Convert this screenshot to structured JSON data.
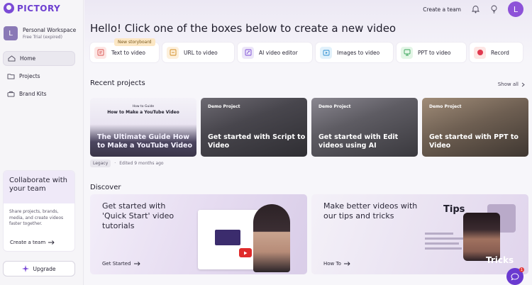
{
  "brand": {
    "name": "PICTORY",
    "color": "#6d3fd0"
  },
  "workspace": {
    "initial": "L",
    "name": "Personal Workspace",
    "status": "Free Trial (expired)"
  },
  "sidebar": {
    "items": [
      {
        "label": "Home",
        "icon": "home-icon",
        "active": true
      },
      {
        "label": "Projects",
        "icon": "folder-icon",
        "active": false
      },
      {
        "label": "Brand Kits",
        "icon": "briefcase-icon",
        "active": false
      }
    ],
    "collab": {
      "title": "Collaborate with your team",
      "body": "Share projects, brands, media, and create videos faster together.",
      "link": "Create a team"
    },
    "upgrade_label": "Upgrade"
  },
  "topbar": {
    "create_team": "Create a team",
    "user_initial": "L"
  },
  "headline": "Hello! Click one of the boxes below to create a new video",
  "actions": [
    {
      "label": "Text to video",
      "icon": "text-video-icon",
      "badge": "New storyboard",
      "color": "#fde6e4"
    },
    {
      "label": "URL to video",
      "icon": "url-video-icon",
      "color": "#fdf0dc"
    },
    {
      "label": "AI video editor",
      "icon": "ai-editor-icon",
      "color": "#ece6f8"
    },
    {
      "label": "Images to video",
      "icon": "images-video-icon",
      "color": "#e1f1fb"
    },
    {
      "label": "PPT to video",
      "icon": "ppt-video-icon",
      "color": "#e3f5e6"
    },
    {
      "label": "Record",
      "icon": "record-icon",
      "color": "#fde6e4"
    }
  ],
  "recent": {
    "title": "Recent projects",
    "show_all": "Show all",
    "projects": [
      {
        "tag": "",
        "title": "The Ultimate Guide How to Make a YouTube Video",
        "thumb_line1": "How to Guide",
        "thumb_line2": "How to Make a YouTube Video"
      },
      {
        "tag": "Demo Project",
        "title": "Get started with Script to Video"
      },
      {
        "tag": "Demo Project",
        "title": "Get started with Edit videos using AI"
      },
      {
        "tag": "Demo Project",
        "title": "Get started with PPT to Video"
      }
    ],
    "meta_badge": "Legacy",
    "meta_edited": "Edited 9 months ago"
  },
  "discover": {
    "title": "Discover",
    "cards": [
      {
        "title": "Get started with 'Quick Start' video tutorials",
        "link": "Get Started"
      },
      {
        "title": "Make better videos with our tips and tricks",
        "link": "How To",
        "art_top": "Tips",
        "art_bottom": "Tricks"
      }
    ]
  },
  "chat": {
    "count": "1"
  }
}
